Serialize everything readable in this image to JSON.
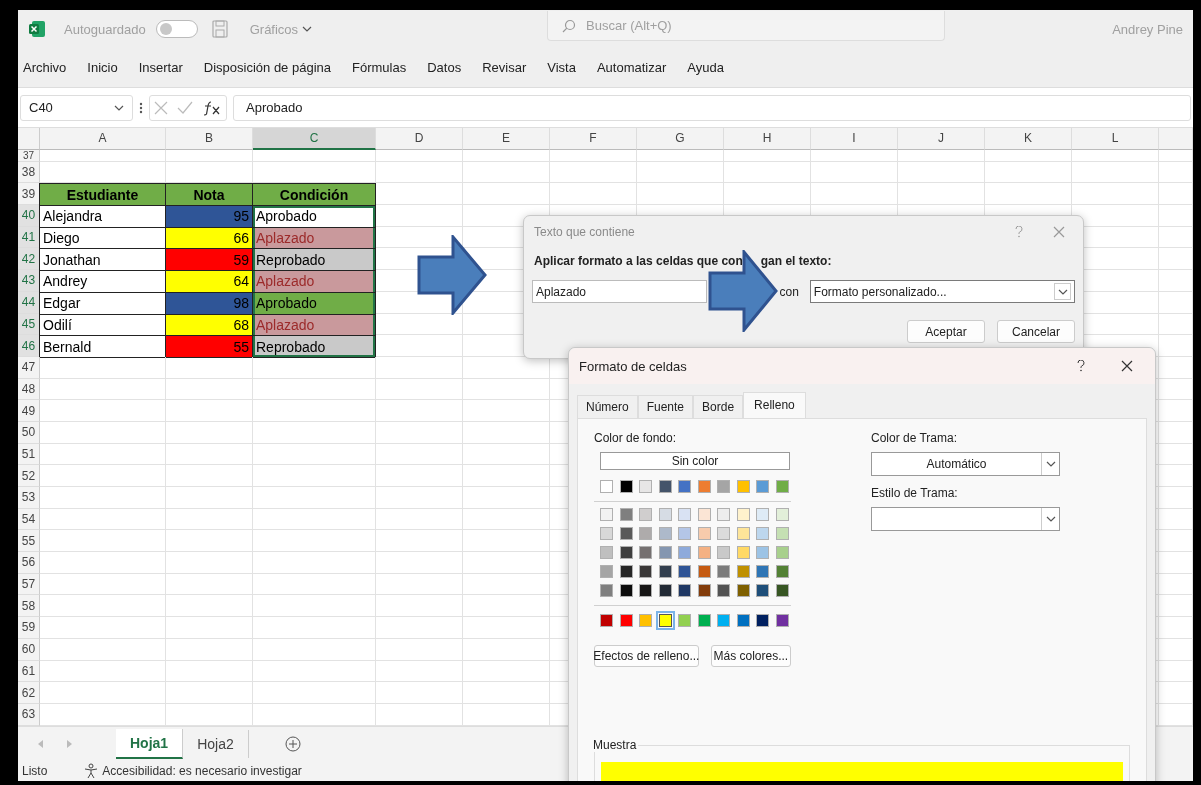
{
  "title_bar": {
    "autosave_label": "Autoguardado",
    "autosave_on": false,
    "file_name": "Gráficos",
    "search_placeholder": "Buscar (Alt+Q)",
    "user_name": "Andrey Pine"
  },
  "menu": [
    "Archivo",
    "Inicio",
    "Insertar",
    "Disposición de página",
    "Fórmulas",
    "Datos",
    "Revisar",
    "Vista",
    "Automatizar",
    "Ayuda"
  ],
  "formula_bar": {
    "name_box": "C40",
    "formula": "Aprobado"
  },
  "columns": [
    {
      "label": "A",
      "selected": false
    },
    {
      "label": "B",
      "selected": false
    },
    {
      "label": "C",
      "selected": true
    },
    {
      "label": "D",
      "selected": false
    },
    {
      "label": "E",
      "selected": false
    },
    {
      "label": "F",
      "selected": false
    },
    {
      "label": "G",
      "selected": false
    },
    {
      "label": "H",
      "selected": false
    },
    {
      "label": "I",
      "selected": false
    },
    {
      "label": "J",
      "selected": false
    },
    {
      "label": "K",
      "selected": false
    },
    {
      "label": "L",
      "selected": false
    }
  ],
  "rows": [
    {
      "number": "37",
      "selected": false
    },
    {
      "number": "38",
      "selected": false
    },
    {
      "number": "39",
      "selected": false,
      "cells": [
        {
          "kind": "header",
          "text": "Estudiante",
          "color": "#70ad47"
        },
        {
          "kind": "header",
          "text": "Nota",
          "color": "#70ad47"
        },
        {
          "kind": "header",
          "text": "Condición",
          "color": "#70ad47"
        }
      ]
    },
    {
      "number": "40",
      "selected": true,
      "cells": [
        {
          "kind": "data",
          "text": "Alejandra",
          "color": "#ffffff"
        },
        {
          "kind": "data",
          "text": "95",
          "color": "#2f5597"
        },
        {
          "kind": "data",
          "text": "Aprobado",
          "color": "#ffffff"
        }
      ]
    },
    {
      "number": "41",
      "selected": true,
      "cells": [
        {
          "kind": "data",
          "text": "Diego",
          "color": "#ffffff"
        },
        {
          "kind": "data",
          "text": "66",
          "color": "#ffff00"
        },
        {
          "kind": "alert",
          "text": "Aplazado",
          "color": "#c9999c"
        }
      ]
    },
    {
      "number": "42",
      "selected": true,
      "cells": [
        {
          "kind": "data",
          "text": "Jonathan",
          "color": "#ffffff"
        },
        {
          "kind": "data",
          "text": "59",
          "color": "#ff0000"
        },
        {
          "kind": "data",
          "text": "Reprobado",
          "color": "#c9c9c9"
        }
      ]
    },
    {
      "number": "43",
      "selected": true,
      "cells": [
        {
          "kind": "data",
          "text": "Andrey",
          "color": "#ffffff"
        },
        {
          "kind": "data",
          "text": "64",
          "color": "#ffff00"
        },
        {
          "kind": "alert",
          "text": "Aplazado",
          "color": "#c9999c"
        }
      ]
    },
    {
      "number": "44",
      "selected": true,
      "cells": [
        {
          "kind": "data",
          "text": "Edgar",
          "color": "#ffffff"
        },
        {
          "kind": "data",
          "text": "98",
          "color": "#2f5597"
        },
        {
          "kind": "data",
          "text": "Aprobado",
          "color": "#70ad47"
        }
      ]
    },
    {
      "number": "45",
      "selected": true,
      "cells": [
        {
          "kind": "data",
          "text": "Odilí",
          "color": "#ffffff"
        },
        {
          "kind": "data",
          "text": "68",
          "color": "#ffff00"
        },
        {
          "kind": "alert",
          "text": "Aplazado",
          "color": "#c9999c"
        }
      ]
    },
    {
      "number": "46",
      "selected": true,
      "cells": [
        {
          "kind": "data",
          "text": "Bernald",
          "color": "#ffffff"
        },
        {
          "kind": "data",
          "text": "55",
          "color": "#ff0000"
        },
        {
          "kind": "data",
          "text": "Reprobado",
          "color": "#c9c9c9"
        }
      ]
    },
    {
      "number": "47",
      "selected": false
    },
    {
      "number": "48",
      "selected": false
    },
    {
      "number": "49",
      "selected": false
    },
    {
      "number": "50",
      "selected": false
    },
    {
      "number": "51",
      "selected": false
    },
    {
      "number": "52",
      "selected": false
    },
    {
      "number": "53",
      "selected": false
    },
    {
      "number": "54",
      "selected": false
    },
    {
      "number": "55",
      "selected": false
    },
    {
      "number": "56",
      "selected": false
    },
    {
      "number": "57",
      "selected": false
    },
    {
      "number": "58",
      "selected": false
    },
    {
      "number": "59",
      "selected": false
    },
    {
      "number": "60",
      "selected": false
    },
    {
      "number": "61",
      "selected": false
    },
    {
      "number": "62",
      "selected": false
    },
    {
      "number": "63",
      "selected": false
    }
  ],
  "sheets": [
    {
      "label": "Hoja1",
      "selected": true
    },
    {
      "label": "Hoja2",
      "selected": false
    }
  ],
  "status_bar": {
    "status": "Listo",
    "accessibility": "Accesibilidad: es necesario investigar"
  },
  "text_dialog": {
    "title": "Texto que contiene",
    "prompt_parts": [
      "Aplicar formato a las celdas que con",
      "gan el texto:"
    ],
    "value": "Aplazado",
    "connector": "con",
    "format": "Formato personalizado...",
    "buttons": [
      "Aceptar",
      "Cancelar"
    ]
  },
  "format_dialog": {
    "title": "Formato de celdas",
    "tabs": [
      {
        "label": "Número",
        "selected": false
      },
      {
        "label": "Fuente",
        "selected": false
      },
      {
        "label": "Borde",
        "selected": false
      },
      {
        "label": "Relleno",
        "selected": true
      }
    ],
    "background_label": "Color de fondo:",
    "no_color": "Sin color",
    "theme_colors": [
      {
        "color": "#ffffff",
        "selected": false
      },
      {
        "color": "#000000",
        "selected": false
      },
      {
        "color": "#e7e6e6",
        "selected": false
      },
      {
        "color": "#44546a",
        "selected": false
      },
      {
        "color": "#4472c4",
        "selected": false
      },
      {
        "color": "#ed7d31",
        "selected": false
      },
      {
        "color": "#a5a5a5",
        "selected": false
      },
      {
        "color": "#ffc000",
        "selected": false
      },
      {
        "color": "#5b9bd5",
        "selected": false
      },
      {
        "color": "#70ad47",
        "selected": false
      }
    ],
    "shades": [
      [
        {
          "color": "#f2f2f2",
          "selected": false
        },
        {
          "color": "#7f7f7f",
          "selected": false
        },
        {
          "color": "#d0cece",
          "selected": false
        },
        {
          "color": "#d6dce4",
          "selected": false
        },
        {
          "color": "#d9e2f3",
          "selected": false
        },
        {
          "color": "#fbe5d5",
          "selected": false
        },
        {
          "color": "#ededed",
          "selected": false
        },
        {
          "color": "#fff2cc",
          "selected": false
        },
        {
          "color": "#deebf6",
          "selected": false
        },
        {
          "color": "#e2efd9",
          "selected": false
        }
      ],
      [
        {
          "color": "#d8d8d8",
          "selected": false
        },
        {
          "color": "#595959",
          "selected": false
        },
        {
          "color": "#aeabab",
          "selected": false
        },
        {
          "color": "#adb9ca",
          "selected": false
        },
        {
          "color": "#b4c6e7",
          "selected": false
        },
        {
          "color": "#f7cbac",
          "selected": false
        },
        {
          "color": "#dbdbdb",
          "selected": false
        },
        {
          "color": "#fee599",
          "selected": false
        },
        {
          "color": "#bdd7ee",
          "selected": false
        },
        {
          "color": "#c5e0b3",
          "selected": false
        }
      ],
      [
        {
          "color": "#bfbfbf",
          "selected": false
        },
        {
          "color": "#3f3f3f",
          "selected": false
        },
        {
          "color": "#757070",
          "selected": false
        },
        {
          "color": "#8496b0",
          "selected": false
        },
        {
          "color": "#8eaadb",
          "selected": false
        },
        {
          "color": "#f4b183",
          "selected": false
        },
        {
          "color": "#c9c9c9",
          "selected": false
        },
        {
          "color": "#ffd965",
          "selected": false
        },
        {
          "color": "#9cc3e5",
          "selected": false
        },
        {
          "color": "#a8d08d",
          "selected": false
        }
      ],
      [
        {
          "color": "#a5a5a5",
          "selected": false
        },
        {
          "color": "#262626",
          "selected": false
        },
        {
          "color": "#3a3838",
          "selected": false
        },
        {
          "color": "#323f4f",
          "selected": false
        },
        {
          "color": "#2f5496",
          "selected": false
        },
        {
          "color": "#c55a11",
          "selected": false
        },
        {
          "color": "#7b7b7b",
          "selected": false
        },
        {
          "color": "#bf9000",
          "selected": false
        },
        {
          "color": "#2e75b5",
          "selected": false
        },
        {
          "color": "#538135",
          "selected": false
        }
      ],
      [
        {
          "color": "#7f7f7f",
          "selected": false
        },
        {
          "color": "#0c0c0c",
          "selected": false
        },
        {
          "color": "#171616",
          "selected": false
        },
        {
          "color": "#222a35",
          "selected": false
        },
        {
          "color": "#1f3864",
          "selected": false
        },
        {
          "color": "#833c0b",
          "selected": false
        },
        {
          "color": "#525252",
          "selected": false
        },
        {
          "color": "#7f6000",
          "selected": false
        },
        {
          "color": "#1e4e79",
          "selected": false
        },
        {
          "color": "#375623",
          "selected": false
        }
      ]
    ],
    "standard_colors": [
      {
        "color": "#c00000",
        "selected": false
      },
      {
        "color": "#ff0000",
        "selected": false
      },
      {
        "color": "#ffc000",
        "selected": false
      },
      {
        "color": "#ffff00",
        "selected": true
      },
      {
        "color": "#92d050",
        "selected": false
      },
      {
        "color": "#00b050",
        "selected": false
      },
      {
        "color": "#00b0f0",
        "selected": false
      },
      {
        "color": "#0070c0",
        "selected": false
      },
      {
        "color": "#002060",
        "selected": false
      },
      {
        "color": "#7030a0",
        "selected": false
      }
    ],
    "buttons": [
      "Efectos de relleno...",
      "Más colores..."
    ],
    "pattern_color_label": "Color de Trama:",
    "pattern_color": "Automático",
    "pattern_style_label": "Estilo de Trama:",
    "sample_label": "Muestra"
  }
}
